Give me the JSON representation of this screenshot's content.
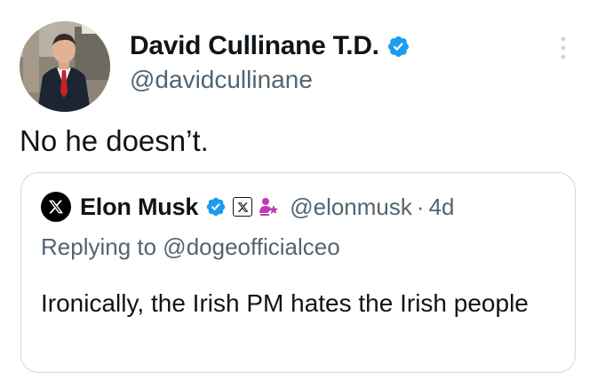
{
  "author": {
    "name": "David Cullinane T.D.",
    "handle": "@davidcullinane",
    "verified": true
  },
  "tweet": {
    "text": "No he doesn’t."
  },
  "quote": {
    "name": "Elon Musk",
    "handle": "@elonmusk",
    "separator": "·",
    "time": "4d",
    "replying_to": "Replying to @dogeofficialceo",
    "text": "Ironically, the Irish PM hates the Irish people"
  },
  "colors": {
    "verified_blue": "#1d9bf0",
    "secondary_text": "#536471",
    "affiliation_pink": "#c03ab5"
  },
  "icons": {
    "more": "more-vertical-icon",
    "verified": "verified-badge-icon",
    "x_logo": "x-logo-icon",
    "affiliation": "government-affiliation-icon"
  }
}
